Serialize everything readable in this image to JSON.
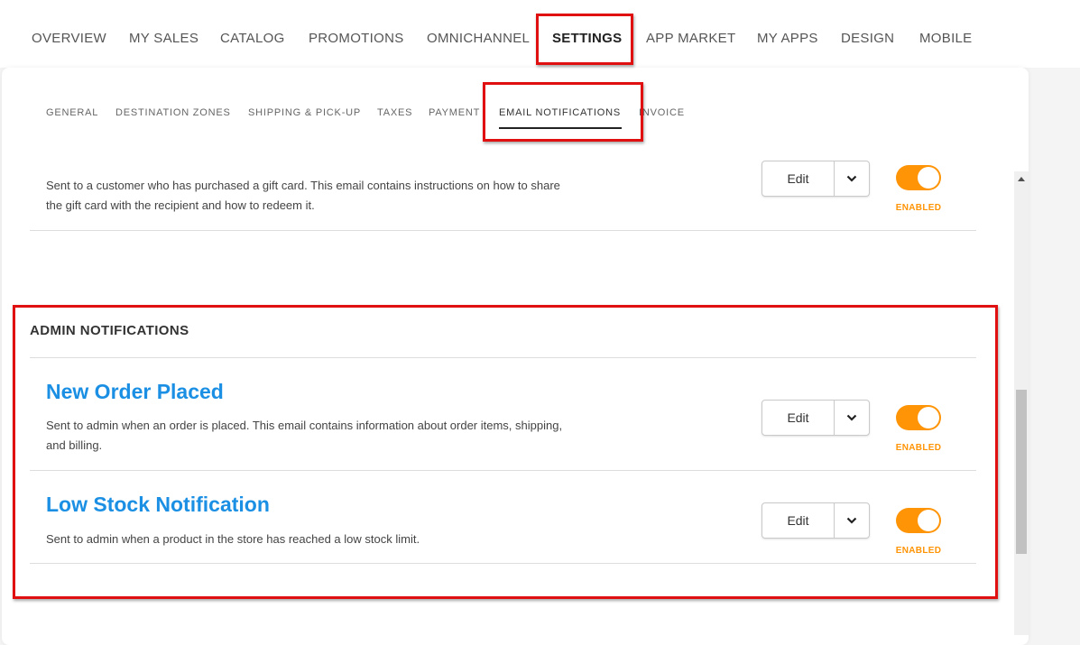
{
  "topnav": {
    "items": [
      "OVERVIEW",
      "MY SALES",
      "CATALOG",
      "PROMOTIONS",
      "OMNICHANNEL",
      "SETTINGS",
      "APP MARKET",
      "MY APPS",
      "DESIGN",
      "MOBILE"
    ],
    "active": "SETTINGS"
  },
  "subnav": {
    "items": [
      "GENERAL",
      "DESTINATION ZONES",
      "SHIPPING & PICK-UP",
      "TAXES",
      "PAYMENT",
      "EMAIL NOTIFICATIONS",
      "INVOICE"
    ],
    "active": "EMAIL NOTIFICATIONS"
  },
  "gift_card": {
    "desc_line1": "Sent to a customer who has purchased a gift card. This email contains instructions on how to share",
    "desc_line2": "the gift card with the recipient and how to redeem it.",
    "edit_label": "Edit",
    "status": "ENABLED"
  },
  "admin": {
    "heading": "ADMIN NOTIFICATIONS",
    "items": [
      {
        "title": "New Order Placed",
        "desc_line1": "Sent to admin when an order is placed. This email contains information about order items, shipping,",
        "desc_line2": "and billing.",
        "edit_label": "Edit",
        "status": "ENABLED"
      },
      {
        "title": "Low Stock Notification",
        "desc_line1": "Sent to admin when a product in the store has reached a low stock limit.",
        "edit_label": "Edit",
        "status": "ENABLED"
      }
    ]
  },
  "colors": {
    "accent_orange": "#ff9406",
    "link_blue": "#1a8fe3",
    "highlight_red": "#e01010"
  },
  "icons": {
    "dropdown": "chevron-down-icon",
    "scroll_up": "scroll-up-arrow-icon"
  }
}
